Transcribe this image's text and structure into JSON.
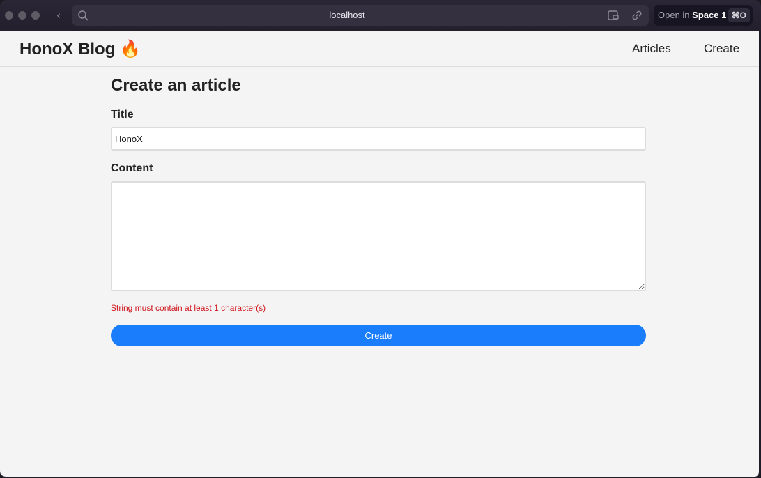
{
  "browser": {
    "url": "localhost",
    "open_in_prefix": "Open in",
    "open_in_space": "Space 1",
    "open_in_shortcut": "⌘O"
  },
  "header": {
    "brand": "HonoX Blog 🔥",
    "nav": [
      {
        "label": "Articles"
      },
      {
        "label": "Create"
      }
    ]
  },
  "form": {
    "heading": "Create an article",
    "title_label": "Title",
    "title_value": "HonoX",
    "content_label": "Content",
    "content_value": "",
    "error": "String must contain at least 1 character(s)",
    "submit_label": "Create"
  },
  "colors": {
    "accent": "#1a7dfc",
    "error": "#d0141c"
  }
}
